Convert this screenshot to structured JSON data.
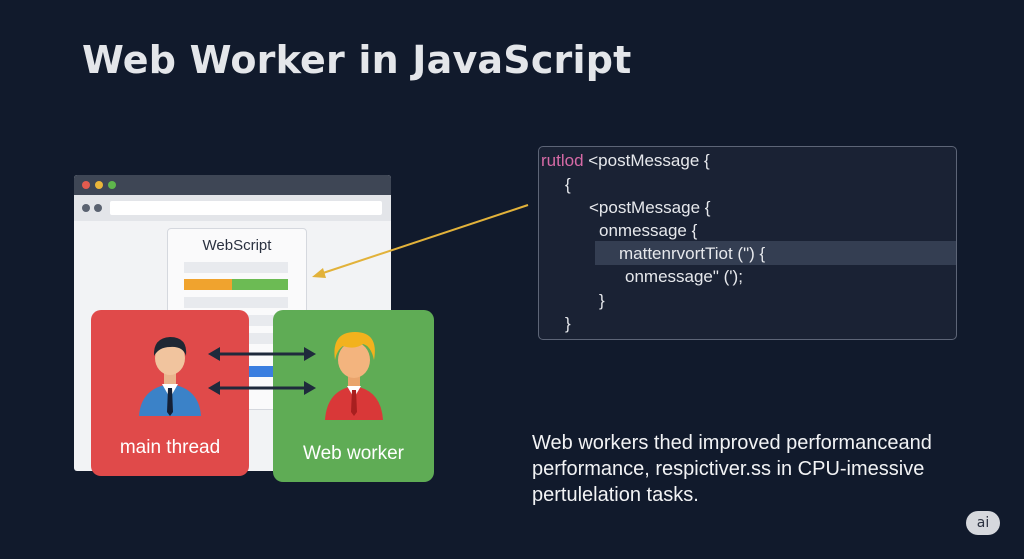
{
  "title": "Web Worker in JavaScript",
  "browser": {
    "card_title": "WebScript"
  },
  "main_thread": {
    "label": "main thread"
  },
  "web_worker": {
    "label": "Web worker"
  },
  "code": {
    "line1_keyword": "rutlod",
    "line1_rest": " <postMessage {",
    "line2": "{",
    "line3": "<postMessage {",
    "line4": "onmessage {",
    "line5": "mattenrvortTiot (\") {",
    "line6": "onmessage\" (');",
    "line7": "}",
    "line8": "}"
  },
  "description": "Web workers thed improved performanceand performance, respictiver.ss in CPU-imessive pertulelation tasks.",
  "badge": "ai",
  "colors": {
    "background": "#111a2c",
    "main_thread": "#e04a4a",
    "web_worker": "#5fac55",
    "pointer_arrow": "#e2b23a",
    "code_keyword": "#d66aa6"
  }
}
